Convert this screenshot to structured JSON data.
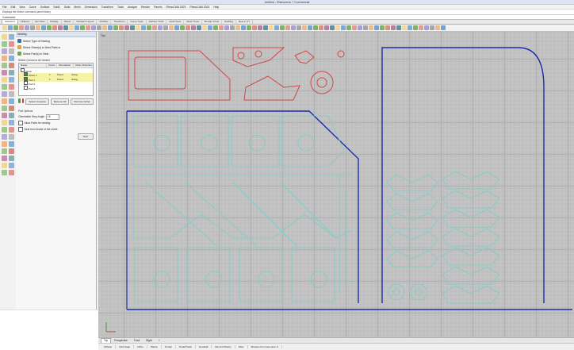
{
  "window": {
    "title": "Untitled - Rhinoceros 7 Commercial"
  },
  "menu": [
    "File",
    "Edit",
    "View",
    "Curve",
    "Surface",
    "SubD",
    "Solid",
    "Mesh",
    "Dimension",
    "Transform",
    "Tools",
    "Analyze",
    "Render",
    "Panels",
    "RhinoCAM 2023",
    "RhinoCAM 2023",
    "Help"
  ],
  "command": {
    "history": "Displays the ribbon command panel history",
    "prompt": "Command:"
  },
  "tabs": [
    "Standard",
    "CPlanes",
    "Set View",
    "Display",
    "Select",
    "Viewport Layout",
    "Visibility",
    "Transform",
    "Curve Tools",
    "Surface Tools",
    "Solid Tools",
    "Mesh Tools",
    "Render Tools",
    "Drafting",
    "New in V7"
  ],
  "panel": {
    "title": "Nesting",
    "actions": [
      "Select Type of Nesting",
      "Select Sheet(s) to Nest Parts in",
      "Select Part(s) to Nest"
    ],
    "section_label": "Select Curves to be nested",
    "tree": {
      "headers": [
        "Name",
        "Count",
        "Orientation",
        "Order Direction"
      ],
      "rows": [
        {
          "name": "Sheet",
          "count": "",
          "orient": "",
          "order": "",
          "sel": false,
          "indent": 0
        },
        {
          "name": "Sheet 1",
          "count": "1",
          "orient": "Fixed",
          "order": "Along",
          "sel": true,
          "indent": 1
        },
        {
          "name": "Part 1",
          "count": "1",
          "orient": "Fixed",
          "order": "Along",
          "sel": true,
          "indent": 1
        },
        {
          "name": "Part 2",
          "count": "",
          "orient": "",
          "order": "",
          "sel": false,
          "indent": 1
        },
        {
          "name": "Part 3",
          "count": "",
          "orient": "",
          "order": "",
          "sel": false,
          "indent": 1
        }
      ]
    },
    "buttons": [
      "Select Curve(s)",
      "Remove All",
      "Remove Active"
    ],
    "options_title": "Part Options",
    "spacing_label": "Orientation Step Angle",
    "spacing_value": "15",
    "checks": [
      "Allow Parts for nesting",
      "Nest from inside of the sheet"
    ],
    "ok": "Nest"
  },
  "viewport": {
    "label": "Top"
  },
  "viewport_tabs": [
    "Top",
    "Perspective",
    "Front",
    "Right",
    "+"
  ],
  "status": [
    "CPlane",
    "Grid Snap",
    "Ortho",
    "Planar",
    "Osnap",
    "SmartTrack",
    "Gumball",
    "Record History",
    "Filter",
    "Minutes from last save: 0"
  ],
  "colors": {
    "accent": "#3d6ea8",
    "sheet": "#1a2ea8",
    "nested": "#78cfc8",
    "parts": "#d14848",
    "grid": "#bfbfbf"
  }
}
